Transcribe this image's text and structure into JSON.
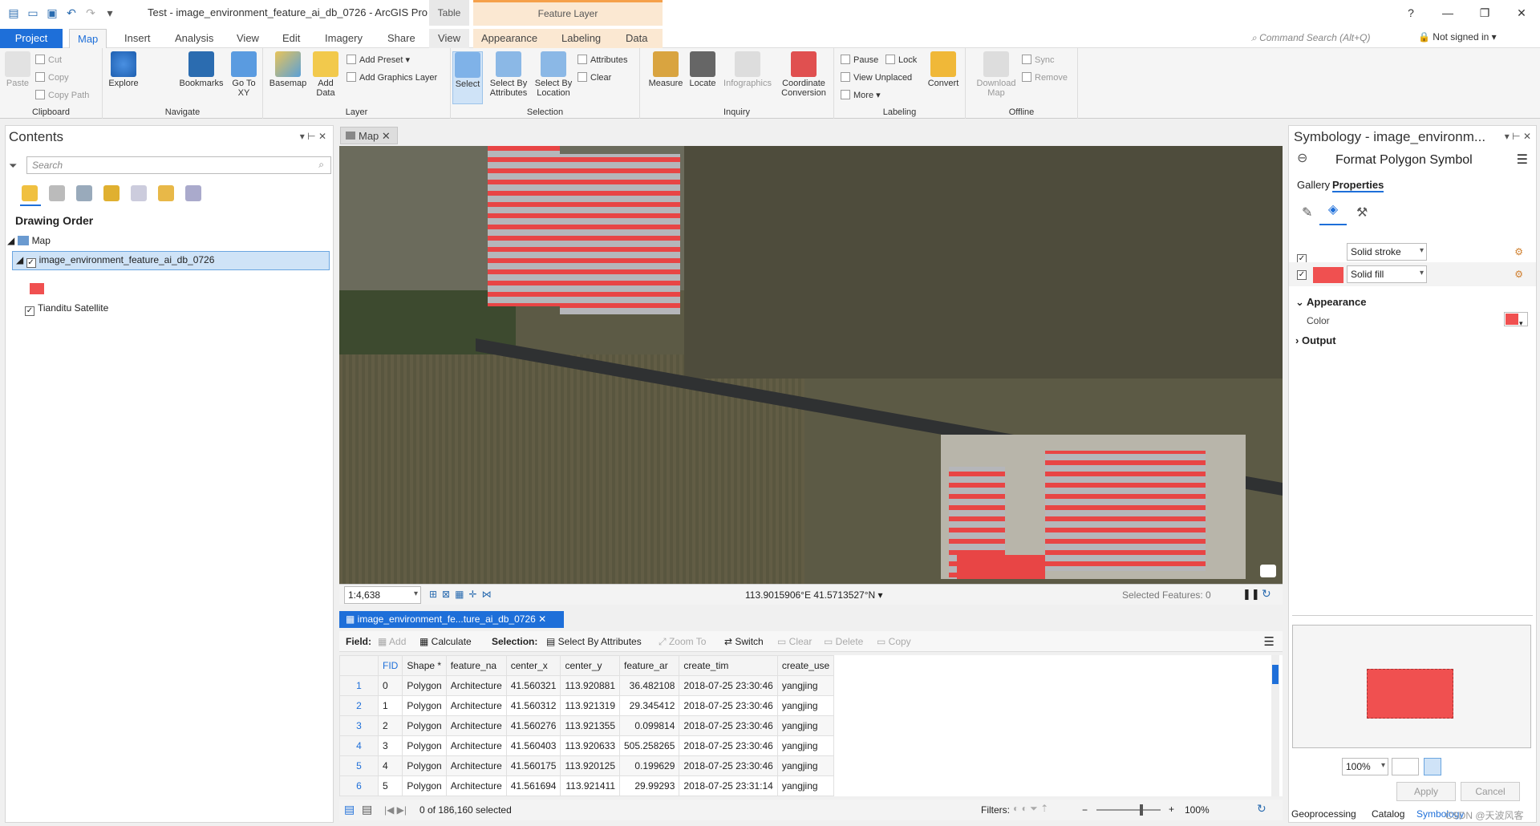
{
  "app": {
    "title": "Test - image_environment_feature_ai_db_0726 - ArcGIS Pro",
    "context_table": "Table",
    "context_feature_layer": "Feature Layer",
    "help": "?",
    "command_search": "Command Search (Alt+Q)",
    "signin": "Not signed in"
  },
  "tabs": [
    "Project",
    "Map",
    "Insert",
    "Analysis",
    "View",
    "Edit",
    "Imagery",
    "Share",
    "View",
    "Appearance",
    "Labeling",
    "Data"
  ],
  "ribbon": {
    "clipboard": {
      "label": "Clipboard",
      "paste": "Paste",
      "cut": "Cut",
      "copy": "Copy",
      "copy_path": "Copy Path"
    },
    "navigate": {
      "label": "Navigate",
      "explore": "Explore",
      "bookmarks": "Bookmarks",
      "goto": "Go To XY"
    },
    "layer": {
      "label": "Layer",
      "basemap": "Basemap",
      "add_data": "Add Data",
      "add_preset": "Add Preset",
      "add_graphics": "Add Graphics Layer"
    },
    "selection": {
      "label": "Selection",
      "select": "Select",
      "by_attr": "Select By Attributes",
      "by_loc": "Select By Location",
      "attributes": "Attributes",
      "clear": "Clear"
    },
    "inquiry": {
      "label": "Inquiry",
      "measure": "Measure",
      "locate": "Locate",
      "infographics": "Infographics",
      "coord": "Coordinate Conversion"
    },
    "labeling": {
      "label": "Labeling",
      "pause": "Pause",
      "lock": "Lock",
      "unplaced": "View Unplaced",
      "more": "More",
      "convert": "Convert"
    },
    "offline": {
      "label": "Offline",
      "download": "Download Map",
      "sync": "Sync",
      "remove": "Remove"
    }
  },
  "contents": {
    "title": "Contents",
    "search_placeholder": "Search",
    "drawing_order": "Drawing Order",
    "map": "Map",
    "layer1": "image_environment_feature_ai_db_0726",
    "layer2": "Tianditu Satellite"
  },
  "map": {
    "tab": "Map",
    "scale": "1:4,638",
    "coords": "113.9015906°E 41.5713527°N",
    "selected": "Selected Features: 0"
  },
  "table": {
    "tab": "image_environment_fe...ture_ai_db_0726",
    "field_label": "Field:",
    "add": "Add",
    "calculate": "Calculate",
    "selection_label": "Selection:",
    "select_by_attr": "Select By Attributes",
    "zoom_to": "Zoom To",
    "switch": "Switch",
    "clear": "Clear",
    "delete": "Delete",
    "copy": "Copy",
    "columns": [
      "FID",
      "Shape *",
      "feature_na",
      "center_x",
      "center_y",
      "feature_ar",
      "create_tim",
      "create_use"
    ],
    "rows": [
      [
        "1",
        "0",
        "Polygon",
        "Architecture",
        "41.560321",
        "113.920881",
        "36.482108",
        "2018-07-25 23:30:46",
        "yangjing"
      ],
      [
        "2",
        "1",
        "Polygon",
        "Architecture",
        "41.560312",
        "113.921319",
        "29.345412",
        "2018-07-25 23:30:46",
        "yangjing"
      ],
      [
        "3",
        "2",
        "Polygon",
        "Architecture",
        "41.560276",
        "113.921355",
        "0.099814",
        "2018-07-25 23:30:46",
        "yangjing"
      ],
      [
        "4",
        "3",
        "Polygon",
        "Architecture",
        "41.560403",
        "113.920633",
        "505.258265",
        "2018-07-25 23:30:46",
        "yangjing"
      ],
      [
        "5",
        "4",
        "Polygon",
        "Architecture",
        "41.560175",
        "113.920125",
        "0.199629",
        "2018-07-25 23:30:46",
        "yangjing"
      ],
      [
        "6",
        "5",
        "Polygon",
        "Architecture",
        "41.561694",
        "113.921411",
        "29.99293",
        "2018-07-25 23:31:14",
        "yangjing"
      ]
    ],
    "selected_status": "0 of 186,160 selected",
    "filters": "Filters:",
    "zoom": "100%"
  },
  "symbology": {
    "title": "Symbology - image_environm...",
    "subtitle": "Format Polygon Symbol",
    "gallery": "Gallery",
    "properties": "Properties",
    "stroke": "Solid stroke",
    "fill": "Solid fill",
    "appearance": "Appearance",
    "color": "Color",
    "output": "Output",
    "zoom": "100%",
    "apply": "Apply",
    "cancel": "Cancel",
    "fill_color": "#f05050"
  },
  "bottom_tabs": [
    "Geoprocessing",
    "Catalog",
    "Symbology"
  ],
  "watermark": "CSDN @天波风客"
}
